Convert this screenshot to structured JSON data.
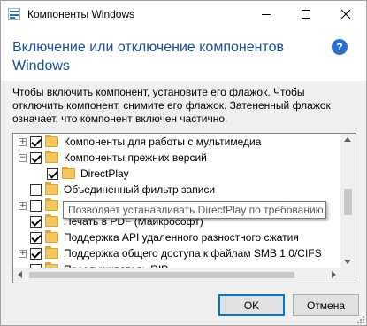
{
  "window": {
    "title": "Компоненты Windows",
    "heading": "Включение или отключение компонентов Windows",
    "help_glyph": "?",
    "description": "Чтобы включить компонент, установите его флажок. Чтобы отключить компонент, снимите его флажок. Затененный флажок означает, что компонент включен частично."
  },
  "tree": {
    "items": [
      {
        "label": "Компоненты для работы с мультимедиа",
        "expander": "+",
        "checked": true
      },
      {
        "label": "Компоненты прежних версий",
        "expander": "−",
        "checked": true
      },
      {
        "label": "DirectPlay",
        "expander": "",
        "checked": true
      },
      {
        "label": "Объединенный фильтр записи",
        "expander": "",
        "checked": false
      },
      {
        "label": "",
        "expander": "+",
        "checked": false
      },
      {
        "label": "Печать в PDF (Майкрософт)",
        "expander": "",
        "checked": true
      },
      {
        "label": "Поддержка API удаленного разностного сжатия",
        "expander": "",
        "checked": true
      },
      {
        "label": "Поддержка общего доступа к файлам SMB 1.0/CIFS",
        "expander": "+",
        "checked": true
      },
      {
        "label": "Прослушиватель RIP",
        "expander": "",
        "checked": false
      }
    ]
  },
  "tooltip": {
    "text": "Позволяет устанавливать DirectPlay по требованию."
  },
  "buttons": {
    "ok": "OK",
    "cancel": "Отмена"
  },
  "colors": {
    "heading": "#1a4f9e",
    "accent": "#0078d7",
    "folder": "#f5c75a"
  }
}
